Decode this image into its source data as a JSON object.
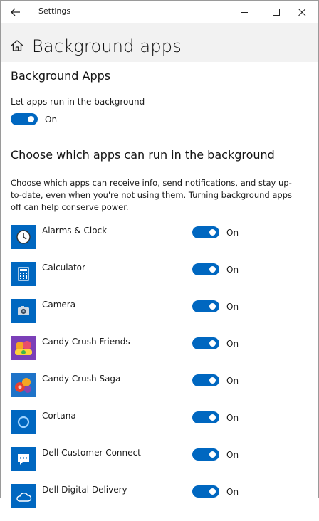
{
  "window": {
    "title": "Settings",
    "back_icon": "back-arrow-icon",
    "minimize_icon": "minimize-icon",
    "maximize_icon": "maximize-icon",
    "close_icon": "close-icon"
  },
  "header": {
    "title": "Background apps",
    "icon": "home-icon"
  },
  "background_apps": {
    "heading": "Background Apps",
    "toggle_label": "Let apps run in the background",
    "toggle_state": "On"
  },
  "choose": {
    "heading": "Choose which apps can run in the background",
    "description": "Choose which apps can receive info, send notifications, and stay up-to-date, even when you're not using them. Turning background apps off can help conserve power."
  },
  "apps": [
    {
      "name": "Alarms & Clock",
      "state": "On",
      "icon": "alarm-clock-icon",
      "color": "#0067c0"
    },
    {
      "name": "Calculator",
      "state": "On",
      "icon": "calculator-icon",
      "color": "#0067c0"
    },
    {
      "name": "Camera",
      "state": "On",
      "icon": "camera-icon",
      "color": "#0067c0"
    },
    {
      "name": "Candy Crush Friends",
      "state": "On",
      "icon": "candy-crush-friends-icon",
      "color": "#7b3fb8"
    },
    {
      "name": "Candy Crush Saga",
      "state": "On",
      "icon": "candy-crush-saga-icon",
      "color": "#1e73c8"
    },
    {
      "name": "Cortana",
      "state": "On",
      "icon": "cortana-icon",
      "color": "#0067c0"
    },
    {
      "name": "Dell Customer Connect",
      "state": "On",
      "icon": "chat-bubble-icon",
      "color": "#0067c0"
    },
    {
      "name": "Dell Digital Delivery",
      "state": "On",
      "icon": "cloud-icon",
      "color": "#0067c0"
    }
  ],
  "colors": {
    "accent": "#0067c0",
    "header_bg": "#f2f2f2"
  }
}
